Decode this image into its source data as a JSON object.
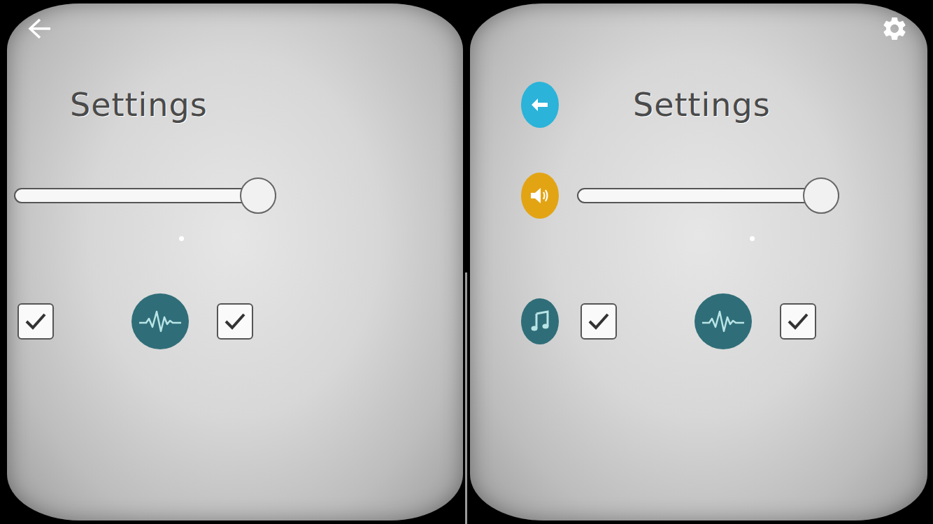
{
  "eyes": [
    {
      "title": "Settings",
      "buttons": [],
      "slider": {
        "level": 1
      },
      "toggles": [
        {
          "kind": "checkbox",
          "checked": true
        },
        {
          "kind": "pulse"
        },
        {
          "kind": "checkbox",
          "checked": true
        }
      ]
    },
    {
      "title": "Settings",
      "buttons": [
        {
          "kind": "back",
          "color": "#2bb3d9"
        },
        {
          "kind": "volume",
          "color": "#e3a414"
        },
        {
          "kind": "music",
          "color": "#2f6e78"
        }
      ],
      "slider": {
        "level": 1
      },
      "toggles": [
        {
          "kind": "checkbox",
          "checked": true
        },
        {
          "kind": "pulse"
        },
        {
          "kind": "checkbox",
          "checked": true
        }
      ]
    }
  ]
}
